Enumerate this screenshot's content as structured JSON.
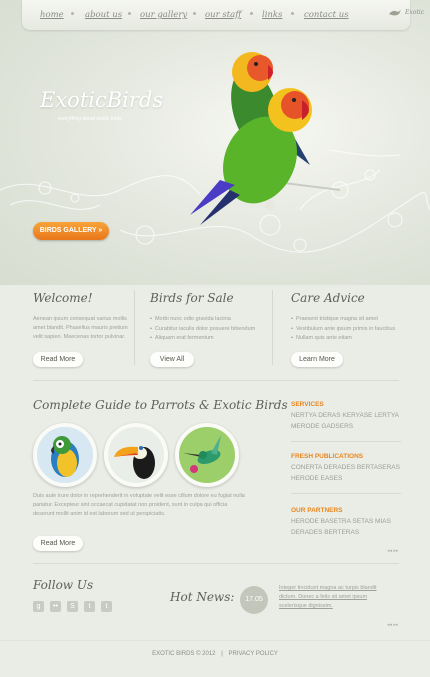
{
  "nav": {
    "items": [
      "home",
      "about us",
      "our gallery",
      "our staff",
      "links",
      "contact us"
    ],
    "bird_text": "Exotic"
  },
  "hero": {
    "logo": "ExoticBirds",
    "tagline": "everything about exotic birds",
    "gallery_button": "BIRDS GALLERY »"
  },
  "columns": [
    {
      "title": "Welcome!",
      "text": "Aenean ipsum consequat varius mollis amet blandit. Phasellus mauris pretium velit sapien. Maecenas tortor pulvinar.",
      "button": "Read More"
    },
    {
      "title": "Birds for Sale",
      "bullets": [
        "Morbi nunc odio gravida lacinia",
        "Curabitur iaculis dolor posuere bibendum",
        "Aliquam erat fermentum"
      ],
      "button": "View All"
    },
    {
      "title": "Care Advice",
      "bullets": [
        "Praesent tristique magna sit amet",
        "Vestibulum ante ipsum primis in faucibus",
        "Nullam quis ante etiam"
      ],
      "button": "Learn More"
    }
  ],
  "guide": {
    "title": "Complete Guide to Parrots & Exotic Birds",
    "text": "Duis aute irure dolor in reprehenderit in voluptate velit esse cillum dolore eu fugiat nulla pariatur. Excepteur sint occaecat cupidatat non proident, sunt in culpa qui officia deserunt mollit anim id est laborum sed ut perspiciatis.",
    "button": "Read More"
  },
  "sidebar": {
    "sections": [
      {
        "head": "SERVICES",
        "lines": [
          "NERTYA DERAS KERYASE LERTYA",
          "MERODE GADSERS"
        ]
      },
      {
        "head": "FRESH PUBLICATIONS",
        "lines": [
          "CONERTA DERADES BERTASERAS",
          "HERODE EASES"
        ]
      },
      {
        "head": "OUR PARTNERS",
        "lines": [
          "HERODE BASETRA SETAS MIAS",
          "DERADES BERTERAS"
        ]
      }
    ],
    "arrows": "◂◂ ▸▸"
  },
  "follow": {
    "title": "Follow Us",
    "icons": [
      "google-icon",
      "flickr-icon",
      "skype-icon",
      "twitter-icon",
      "tumblr-icon"
    ],
    "glyphs": [
      "g",
      "••",
      "S",
      "t",
      "t"
    ]
  },
  "news": {
    "title": "Hot News:",
    "date": "17.05",
    "text": "Integer tincidunt magna ac turpis blandit dictum. Donec a felis sit amet ipsum scelerisque dignissim."
  },
  "footer": {
    "copyright": "EXOTIC BIRDS © 2012",
    "sep": "|",
    "policy": "PRIVACY POLICY"
  },
  "colors": {
    "accent": "#e9861e",
    "background": "#eaede6"
  }
}
